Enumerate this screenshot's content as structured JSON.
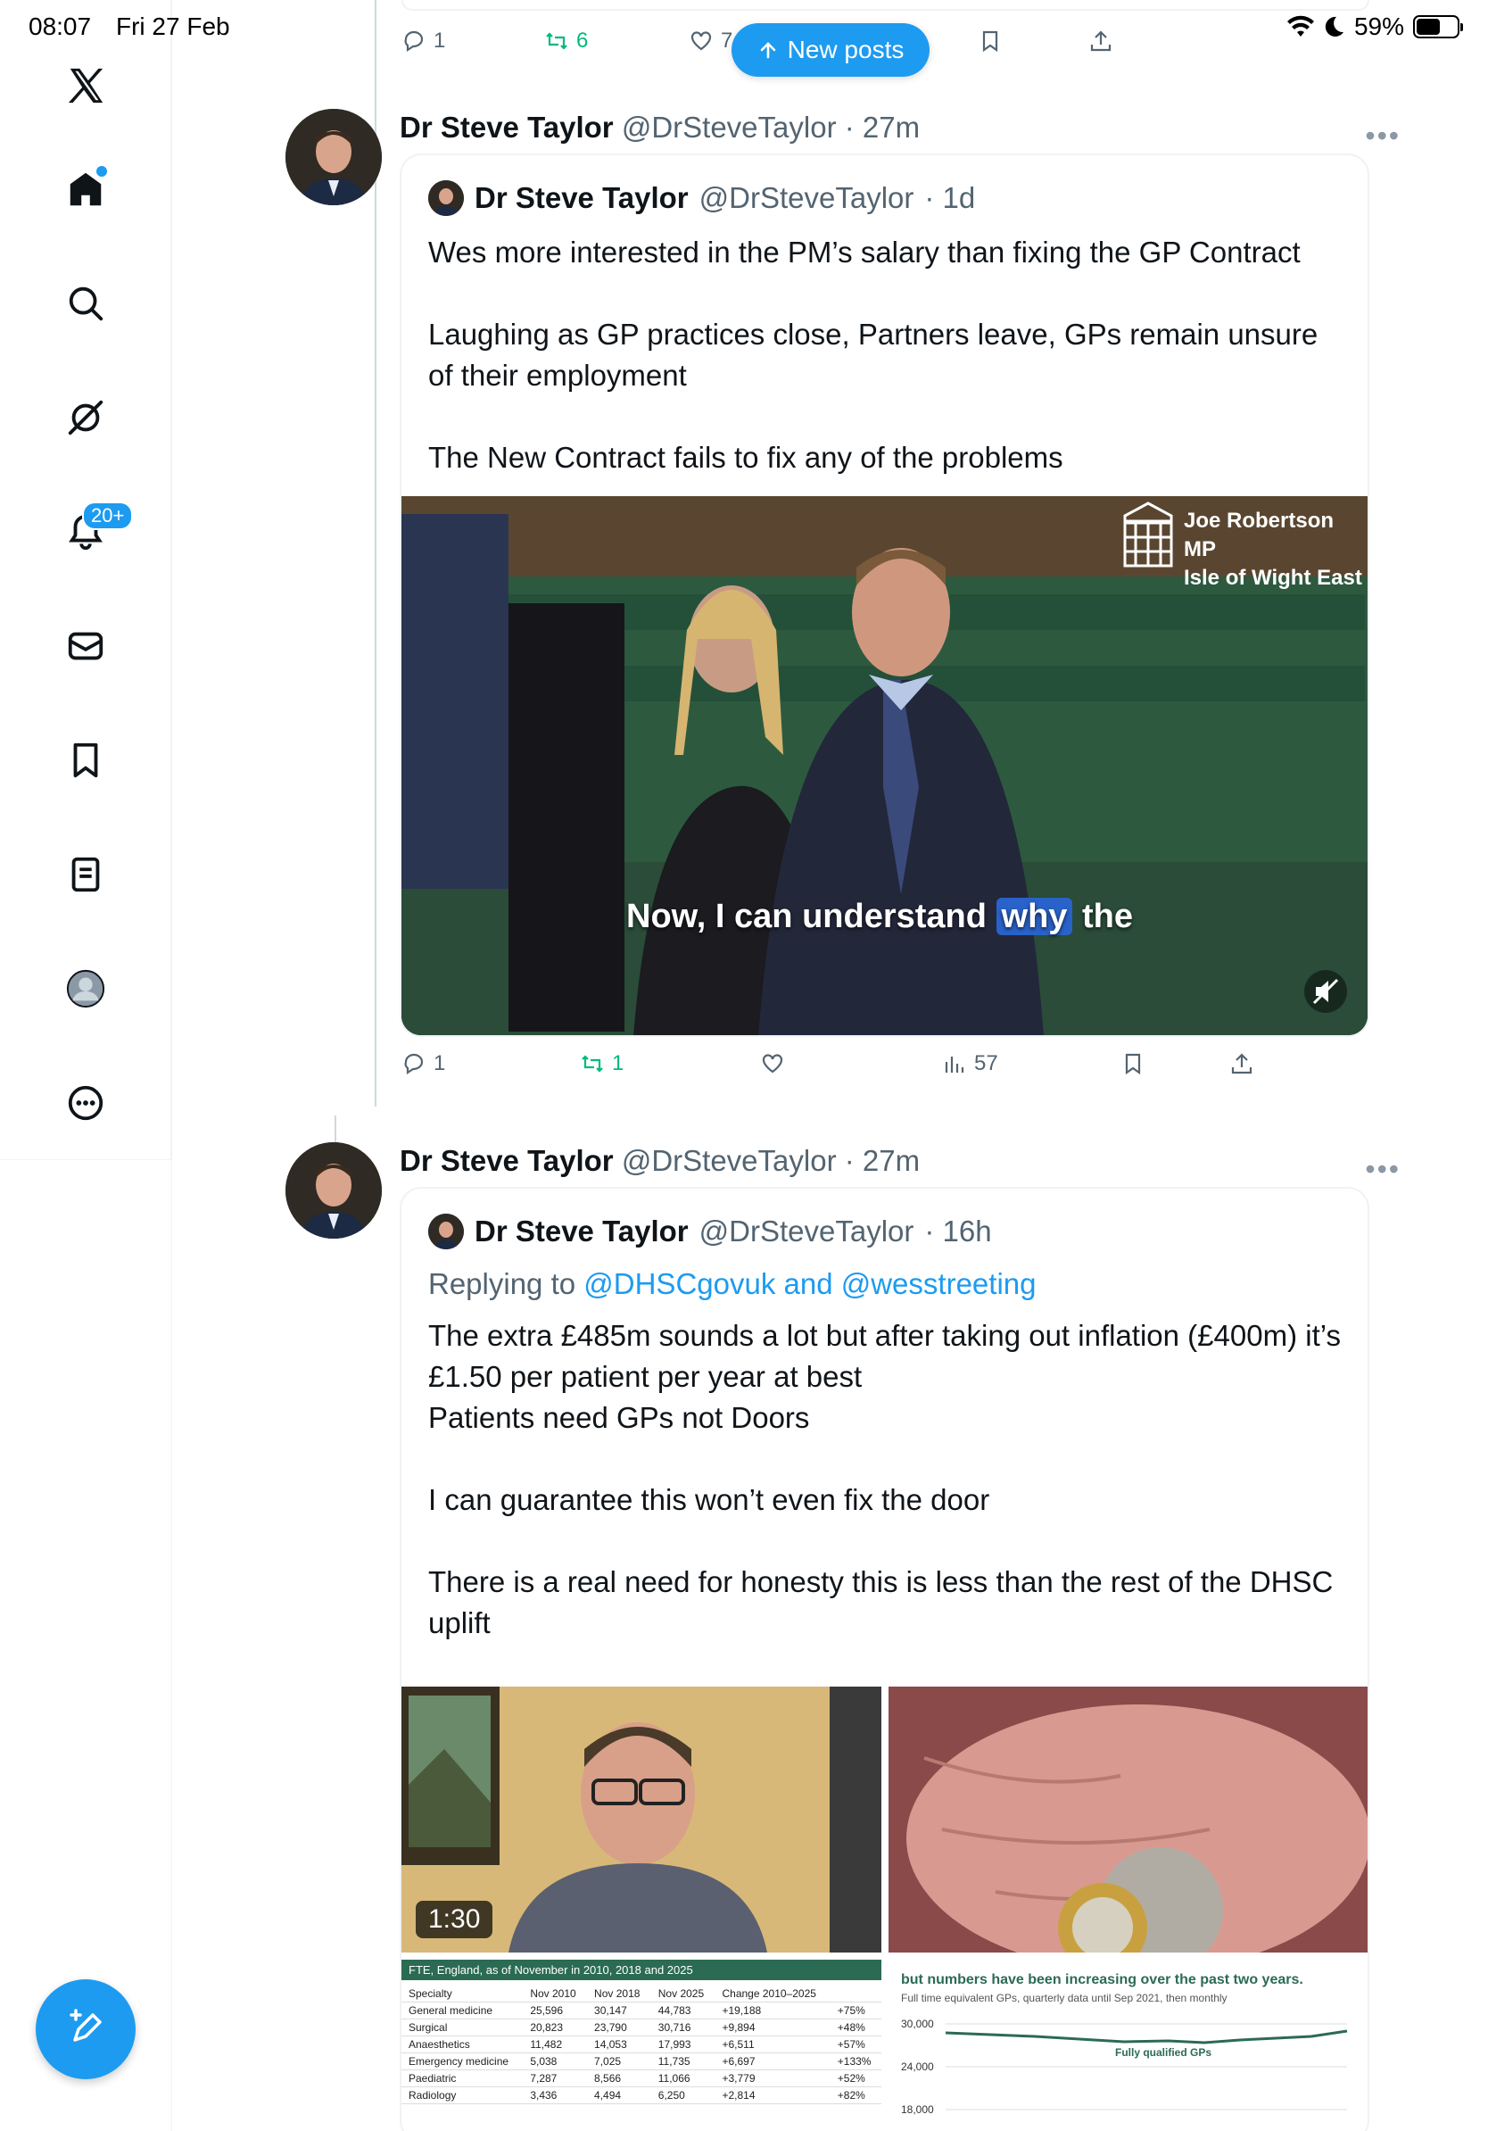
{
  "status_bar": {
    "time": "08:07",
    "date": "Fri 27 Feb",
    "battery": "59%",
    "battery_level": 0.59
  },
  "sidebar": {
    "notifications_badge": "20+",
    "items": [
      "x-logo",
      "home-icon",
      "search-icon",
      "grok-icon",
      "bell-icon",
      "mail-icon",
      "bookmark-icon",
      "lists-icon",
      "profile-icon",
      "more-icon"
    ]
  },
  "new_posts_label": "New posts",
  "prev_tweet_actions": {
    "replies": "1",
    "reposts": "6",
    "likes": "7"
  },
  "tweets": [
    {
      "name": "Dr Steve Taylor",
      "handle": "@DrSteveTaylor",
      "time": "· 27m",
      "quote": {
        "name": "Dr Steve Taylor",
        "handle": "@DrSteveTaylor",
        "time": "· 1d",
        "text": [
          "Wes more interested in the PM’s salary than fixing the GP Contract",
          "Laughing as GP practices close, Partners leave, GPs remain unsure of their employment",
          "The New Contract fails to fix any of the problems"
        ],
        "video": {
          "caption_pre": "Now, I can understand ",
          "caption_hl": "why",
          "caption_post": " the",
          "mp_name": "Joe Robertson MP",
          "mp_constituency": "Isle of Wight East"
        }
      },
      "actions": {
        "replies": "1",
        "reposts": "1",
        "likes": "",
        "views": "57"
      }
    },
    {
      "name": "Dr Steve Taylor",
      "handle": "@DrSteveTaylor",
      "time": "· 27m",
      "quote": {
        "name": "Dr Steve Taylor",
        "handle": "@DrSteveTaylor",
        "time": "· 16h",
        "replying_prefix": "Replying to ",
        "replying_links": "@DHSCgovuk and @wesstreeting",
        "text": [
          "The extra £485m sounds a lot but after taking out inflation (£400m) it’s £1.50 per patient per year at best",
          "Patients need GPs not Doors",
          "I can guarantee this won’t even fix the door",
          "There is a real need for honesty this is less than the rest of the DHSC uplift"
        ],
        "video_duration": "1:30",
        "table": {
          "title": "FTE, England, as of November in 2010, 2018 and 2025",
          "headers": [
            "Specialty",
            "Nov 2010",
            "Nov 2018",
            "Nov 2025",
            "Change 2010–2025",
            ""
          ],
          "rows": [
            [
              "General medicine",
              "25,596",
              "30,147",
              "44,783",
              "+19,188",
              "+75%"
            ],
            [
              "Surgical",
              "20,823",
              "23,790",
              "30,716",
              "+9,894",
              "+48%"
            ],
            [
              "Anaesthetics",
              "11,482",
              "14,053",
              "17,993",
              "+6,511",
              "+57%"
            ],
            [
              "Emergency medicine",
              "5,038",
              "7,025",
              "11,735",
              "+6,697",
              "+133%"
            ],
            [
              "Paediatric",
              "7,287",
              "8,566",
              "11,066",
              "+3,779",
              "+52%"
            ],
            [
              "Radiology",
              "3,436",
              "4,494",
              "6,250",
              "+2,814",
              "+82%"
            ]
          ]
        },
        "chart": {
          "heading": "but numbers have been increasing over the past two years.",
          "subheading": "Full time equivalent GPs, quarterly data until Sep 2021, then monthly",
          "series_label": "Fully qualified GPs",
          "y_ticks": [
            "30,000",
            "24,000",
            "18,000"
          ]
        }
      }
    }
  ]
}
